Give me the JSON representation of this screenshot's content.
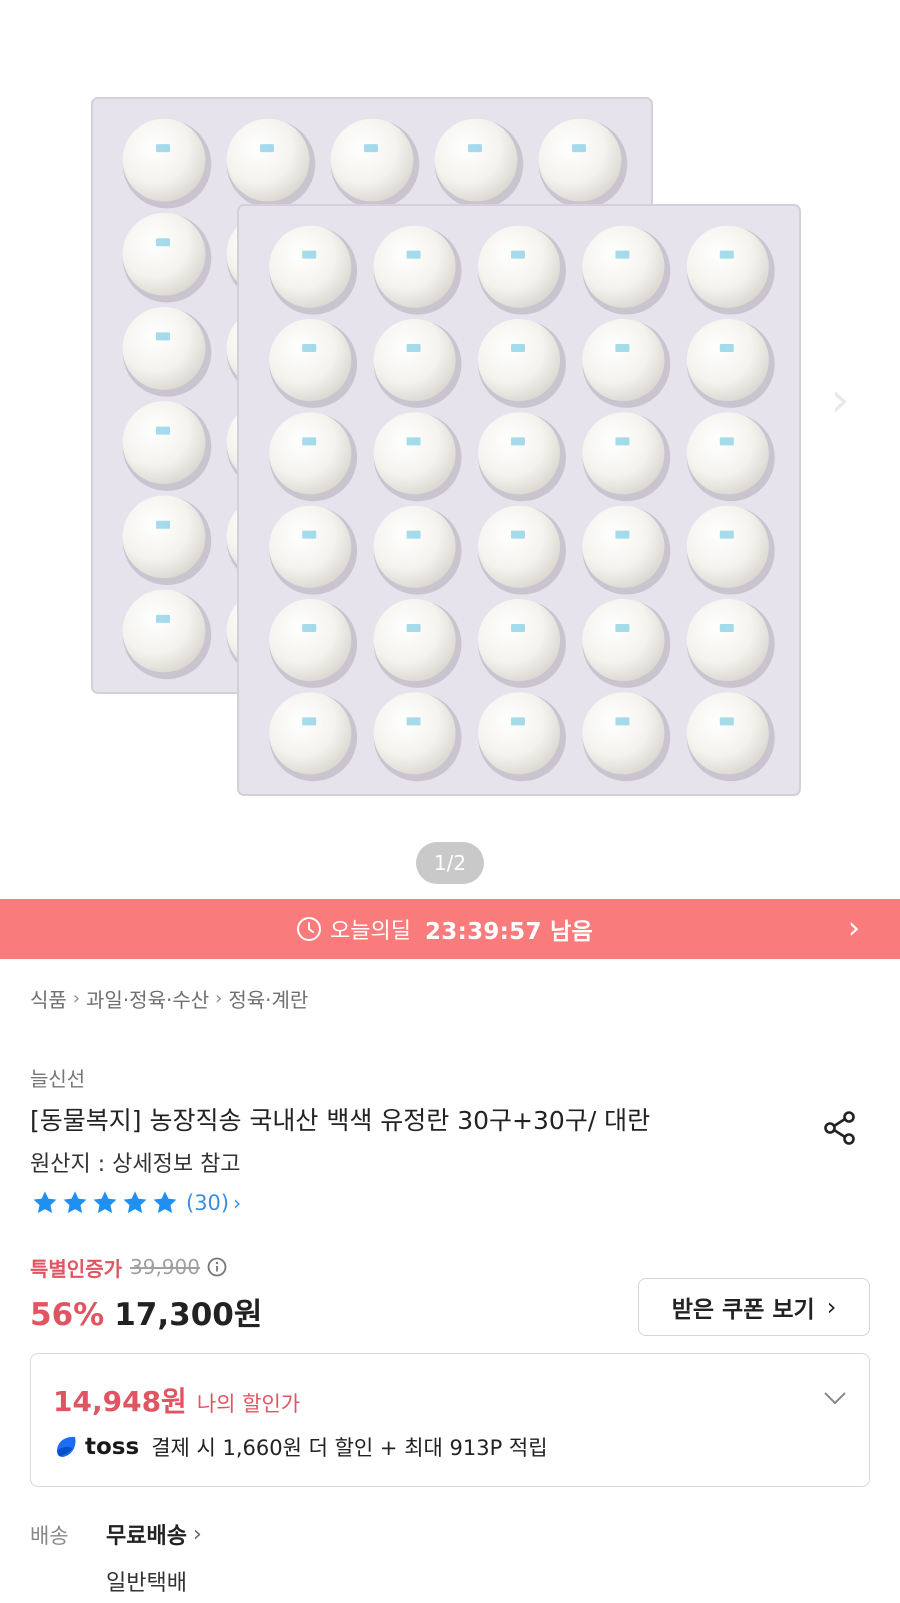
{
  "hero": {
    "image_desc_icon": "egg-tray-photo",
    "pager": "1/2",
    "next_icon": "chevron-right-icon"
  },
  "deal_banner": {
    "icon": "clock-icon",
    "label": "오늘의딜",
    "timer": "23:39:57 남음",
    "color": "#f97b7b"
  },
  "breadcrumb": [
    "식품",
    "과일·정육·수산",
    "정육·계란"
  ],
  "product": {
    "seller": "늘신선",
    "title": "[동물복지] 농장직송 국내산 백색 유정란 30구+30구/  대란",
    "origin": "원산지 : 상세정보 참고",
    "rating": {
      "stars": 5,
      "count_text": "(30)",
      "chevron": "›"
    }
  },
  "price": {
    "label": "특별인증가",
    "original": "39,900",
    "discount": "56%",
    "sale": "17,300원",
    "coupon_button": "받은 쿠폰 보기",
    "accent": "#e05561"
  },
  "my_discount": {
    "price": "14,948원",
    "label": "나의 할인가",
    "toss_brand": "toss",
    "toss_text": "결제 시 1,660원 더 할인 + 최대 913P 적립"
  },
  "shipping": {
    "label": "배송",
    "value": "무료배송",
    "sub": "일반택배"
  }
}
